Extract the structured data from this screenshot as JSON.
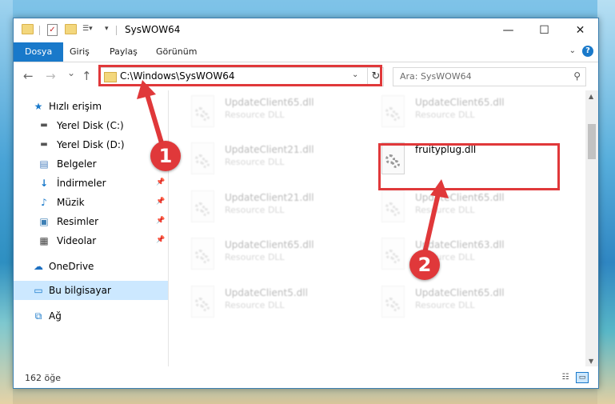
{
  "window": {
    "title": "SysWOW64",
    "minimize_glyph": "—",
    "maximize_glyph": "☐",
    "close_glyph": "✕"
  },
  "ribbon": {
    "tabs": [
      {
        "label": "Dosya",
        "active": true
      },
      {
        "label": "Giriş",
        "active": false
      },
      {
        "label": "Paylaş",
        "active": false
      },
      {
        "label": "Görünüm",
        "active": false
      }
    ],
    "help_glyph": "?"
  },
  "navigation": {
    "back_glyph": "←",
    "forward_glyph": "→",
    "recent_glyph": "⌄",
    "up_glyph": "↑",
    "address": "C:\\Windows\\SysWOW64",
    "search_placeholder": "Ara: SysWOW64"
  },
  "sidebar": {
    "items": [
      {
        "label": "Hızlı erişim",
        "icon": "star-icon",
        "pinned": false,
        "selected": false
      },
      {
        "label": "Yerel Disk (C:)",
        "icon": "drive-icon",
        "pinned": false,
        "selected": false
      },
      {
        "label": "Yerel Disk (D:)",
        "icon": "drive-icon",
        "pinned": false,
        "selected": false
      },
      {
        "label": "Belgeler",
        "icon": "documents-icon",
        "pinned": false,
        "selected": false
      },
      {
        "label": "İndirmeler",
        "icon": "download-icon",
        "pinned": true,
        "selected": false
      },
      {
        "label": "Müzik",
        "icon": "music-icon",
        "pinned": true,
        "selected": false
      },
      {
        "label": "Resimler",
        "icon": "pictures-icon",
        "pinned": true,
        "selected": false
      },
      {
        "label": "Videolar",
        "icon": "videos-icon",
        "pinned": true,
        "selected": false
      },
      {
        "label": "OneDrive",
        "icon": "cloud-icon",
        "pinned": false,
        "selected": false
      },
      {
        "label": "Bu bilgisayar",
        "icon": "computer-icon",
        "pinned": false,
        "selected": true
      },
      {
        "label": "Ağ",
        "icon": "network-icon",
        "pinned": false,
        "selected": false
      }
    ]
  },
  "files": [
    {
      "name": "UpdateClient65.dll",
      "type": "Resource DLL",
      "faded": true
    },
    {
      "name": "UpdateClient65.dll",
      "type": "Resource DLL",
      "faded": true
    },
    {
      "name": "UpdateClient21.dll",
      "type": "Resource DLL",
      "faded": true
    },
    {
      "name": "fruityplug.dll",
      "type": "",
      "faded": false
    },
    {
      "name": "UpdateClient21.dll",
      "type": "Resource DLL",
      "faded": true
    },
    {
      "name": "UpdateClient65.dll",
      "type": "Resource DLL",
      "faded": true
    },
    {
      "name": "UpdateClient65.dll",
      "type": "Resource DLL",
      "faded": true
    },
    {
      "name": "UpdateClient63.dll",
      "type": "Resource DLL",
      "faded": true
    },
    {
      "name": "UpdateClient5.dll",
      "type": "Resource DLL",
      "faded": true
    },
    {
      "name": "UpdateClient65.dll",
      "type": "Resource DLL",
      "faded": true
    }
  ],
  "status": {
    "item_count": "162 öğe"
  },
  "annotations": {
    "step1": "1",
    "step2": "2",
    "color": "#e0383a"
  }
}
